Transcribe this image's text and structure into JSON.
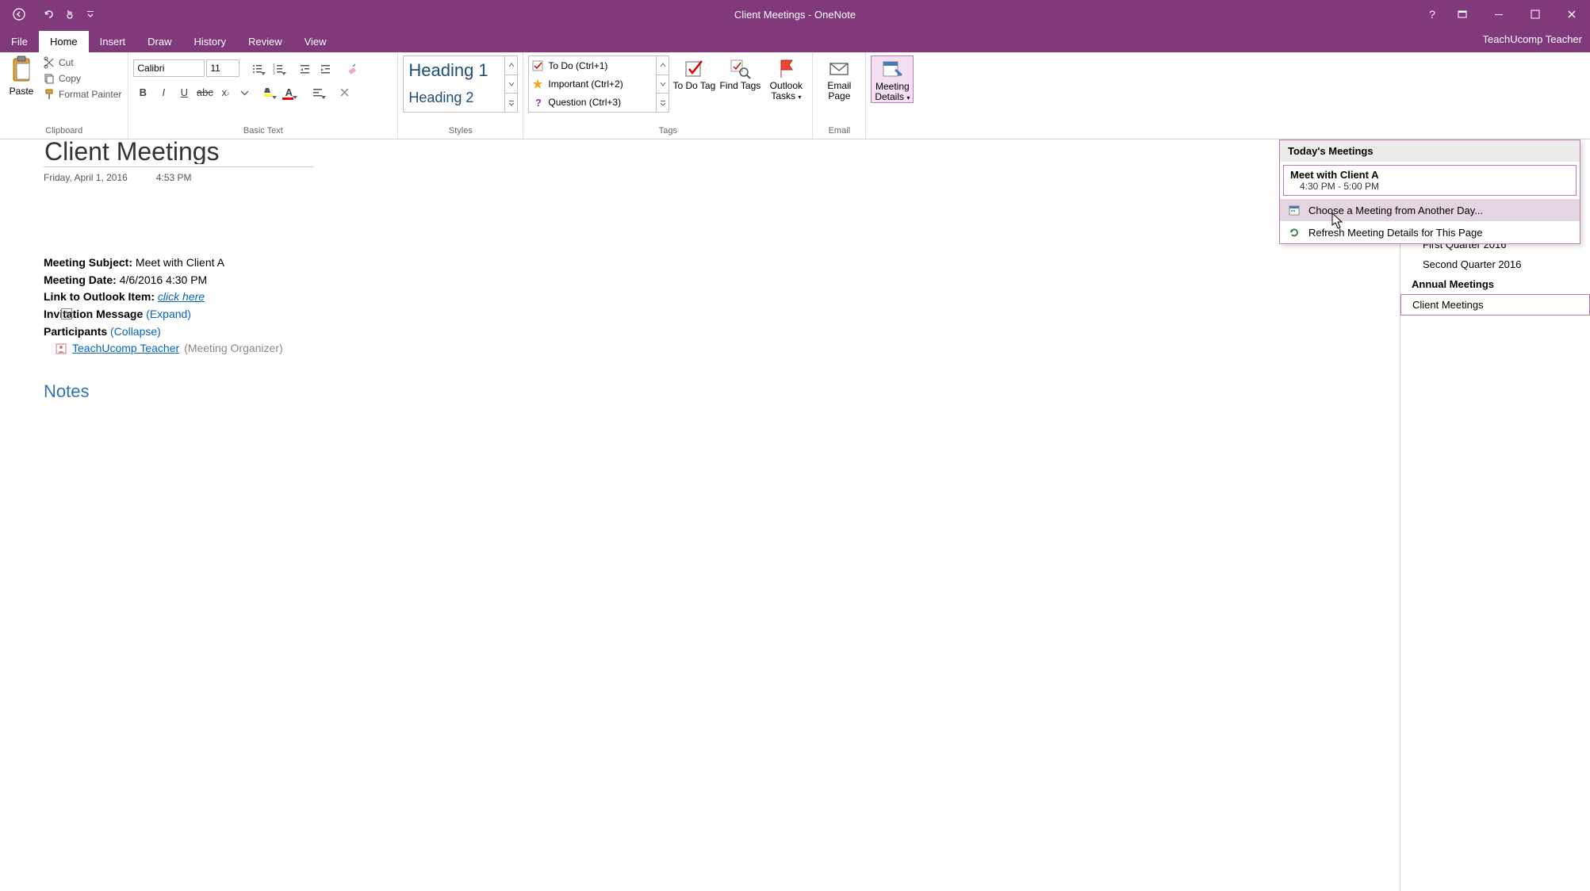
{
  "title": "Client Meetings - OneNote",
  "user": "TeachUcomp Teacher",
  "tabs": {
    "file": "File",
    "home": "Home",
    "insert": "Insert",
    "draw": "Draw",
    "history": "History",
    "review": "Review",
    "view": "View"
  },
  "ribbon": {
    "clipboard": {
      "paste": "Paste",
      "cut": "Cut",
      "copy": "Copy",
      "format_painter": "Format Painter",
      "label": "Clipboard"
    },
    "basic_text": {
      "font": "Calibri",
      "size": "11",
      "label": "Basic Text"
    },
    "styles": {
      "h1": "Heading 1",
      "h2": "Heading 2",
      "label": "Styles"
    },
    "tags": {
      "todo": "To Do (Ctrl+1)",
      "important": "Important (Ctrl+2)",
      "question": "Question (Ctrl+3)",
      "todo_tag": "To Do Tag",
      "find_tags": "Find Tags",
      "outlook_tasks": "Outlook Tasks",
      "label": "Tags"
    },
    "email": {
      "email_page": "Email Page",
      "label": "Email"
    },
    "meetings": {
      "meeting_details": "Meeting Details"
    }
  },
  "dropdown": {
    "header": "Today's Meetings",
    "meeting_title": "Meet with Client A",
    "meeting_time": "4:30 PM - 5:00 PM",
    "choose": "Choose a Meeting from Another Day...",
    "refresh": "Refresh Meeting Details for This Page"
  },
  "page": {
    "title": "Client Meetings",
    "date": "Friday, April 1, 2016",
    "time": "4:53 PM",
    "subject_label": "Meeting Subject:",
    "subject_value": "Meet with Client A",
    "date_label": "Meeting Date:",
    "date_value": "4/6/2016 4:30 PM",
    "link_label": "Link to Outlook Item:",
    "link_value": "click here",
    "invitation_label": "Invitation Message",
    "expand": "(Expand)",
    "participants_label": "Participants",
    "collapse": "(Collapse)",
    "organizer_name": "TeachUcomp Teacher",
    "organizer_role": "(Meeting Organizer)",
    "notes": "Notes"
  },
  "sidebar": {
    "annual": "Annual Meetings",
    "client": "Client Meetings",
    "q1": "First Quarter 2016",
    "q2": "Second Quarter 2016"
  }
}
